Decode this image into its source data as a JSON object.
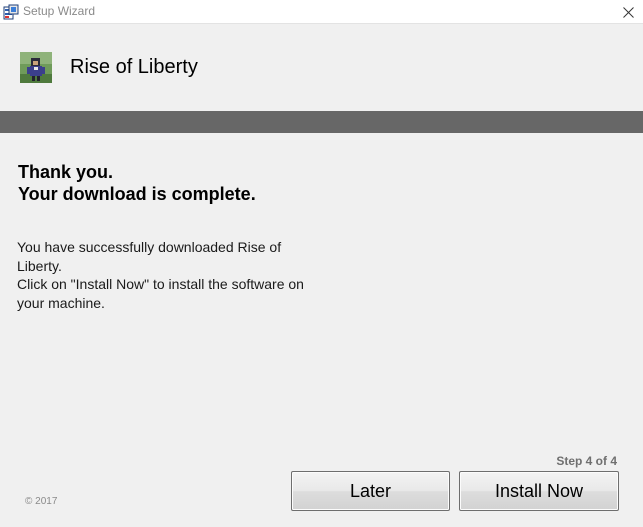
{
  "window": {
    "title": "Setup Wizard",
    "icon": "setup-installer-icon",
    "close_icon": "close-icon"
  },
  "header": {
    "product_name": "Rise of Liberty",
    "logo": "game-thumbnail"
  },
  "content": {
    "heading_line1": "Thank you.",
    "heading_line2": "Your download is complete.",
    "body_line1": "You have successfully downloaded Rise of Liberty.",
    "body_line2": "Click on \"Install Now\" to install the software on your machine."
  },
  "footer": {
    "step": "Step 4 of 4",
    "copyright": "© 2017",
    "later_label": "Later",
    "install_label": "Install Now"
  },
  "colors": {
    "background": "#f0f0f0",
    "divider": "#676767",
    "titlebar": "#ffffff"
  }
}
